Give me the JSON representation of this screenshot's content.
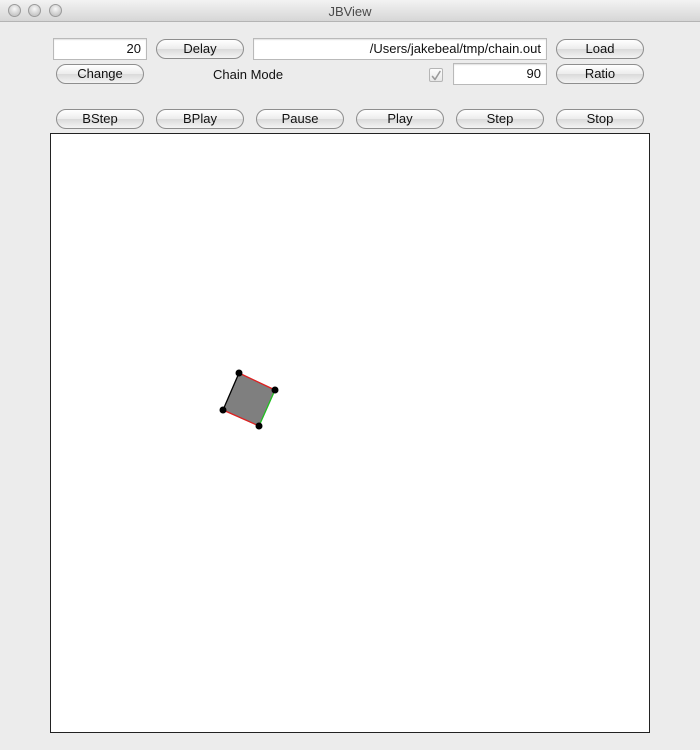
{
  "window": {
    "title": "JBView"
  },
  "controls": {
    "delay_value": "20",
    "delay_button": "Delay",
    "file_path": "/Users/jakebeal/tmp/chain.out",
    "load_button": "Load",
    "change_button": "Change",
    "chain_mode_label": "Chain Mode",
    "chain_mode_checked": true,
    "ratio_value": "90",
    "ratio_button": "Ratio"
  },
  "playback": {
    "bstep": "BStep",
    "bplay": "BPlay",
    "pause": "Pause",
    "play": "Play",
    "step": "Step",
    "stop": "Stop"
  },
  "colors": {
    "shape_fill": "#7f7f7f",
    "red_edge": "#e02020",
    "green_edge": "#20c020",
    "vertex": "#000000"
  }
}
